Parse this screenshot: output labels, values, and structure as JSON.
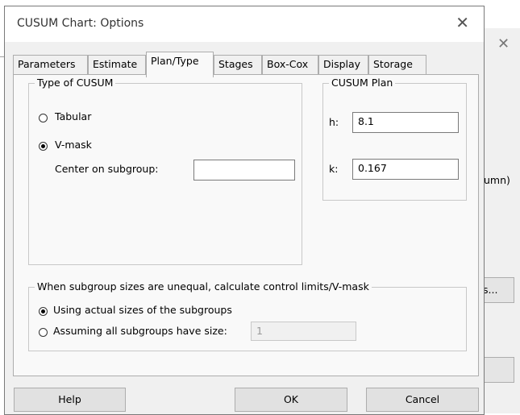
{
  "background_window": {
    "close_glyph": "✕",
    "partial_text_1": "umn)",
    "partial_button_label": "s..."
  },
  "dialog": {
    "title": "CUSUM Chart: Options",
    "close_glyph": "✕"
  },
  "tabs": [
    {
      "label": "Parameters"
    },
    {
      "label": "Estimate"
    },
    {
      "label": "Plan/Type",
      "active": true
    },
    {
      "label": "Stages"
    },
    {
      "label": "Box-Cox"
    },
    {
      "label": "Display"
    },
    {
      "label": "Storage"
    }
  ],
  "type_group": {
    "legend": "Type of CUSUM",
    "tabular_label": "Tabular",
    "vmask_label": "V-mask",
    "center_label": "Center on subgroup:",
    "center_value": "",
    "selected": "V-mask"
  },
  "plan_group": {
    "legend": "CUSUM Plan",
    "h_label": "h:",
    "h_value": "8.1",
    "k_label": "k:",
    "k_value": "0.167"
  },
  "unequal_group": {
    "legend": "When subgroup sizes are unequal, calculate control limits/V-mask",
    "actual_label": "Using actual sizes of the subgroups",
    "assume_label": "Assuming all subgroups have size:",
    "assume_value": "1",
    "selected": "actual"
  },
  "buttons": {
    "help": "Help",
    "ok": "OK",
    "cancel": "Cancel"
  }
}
